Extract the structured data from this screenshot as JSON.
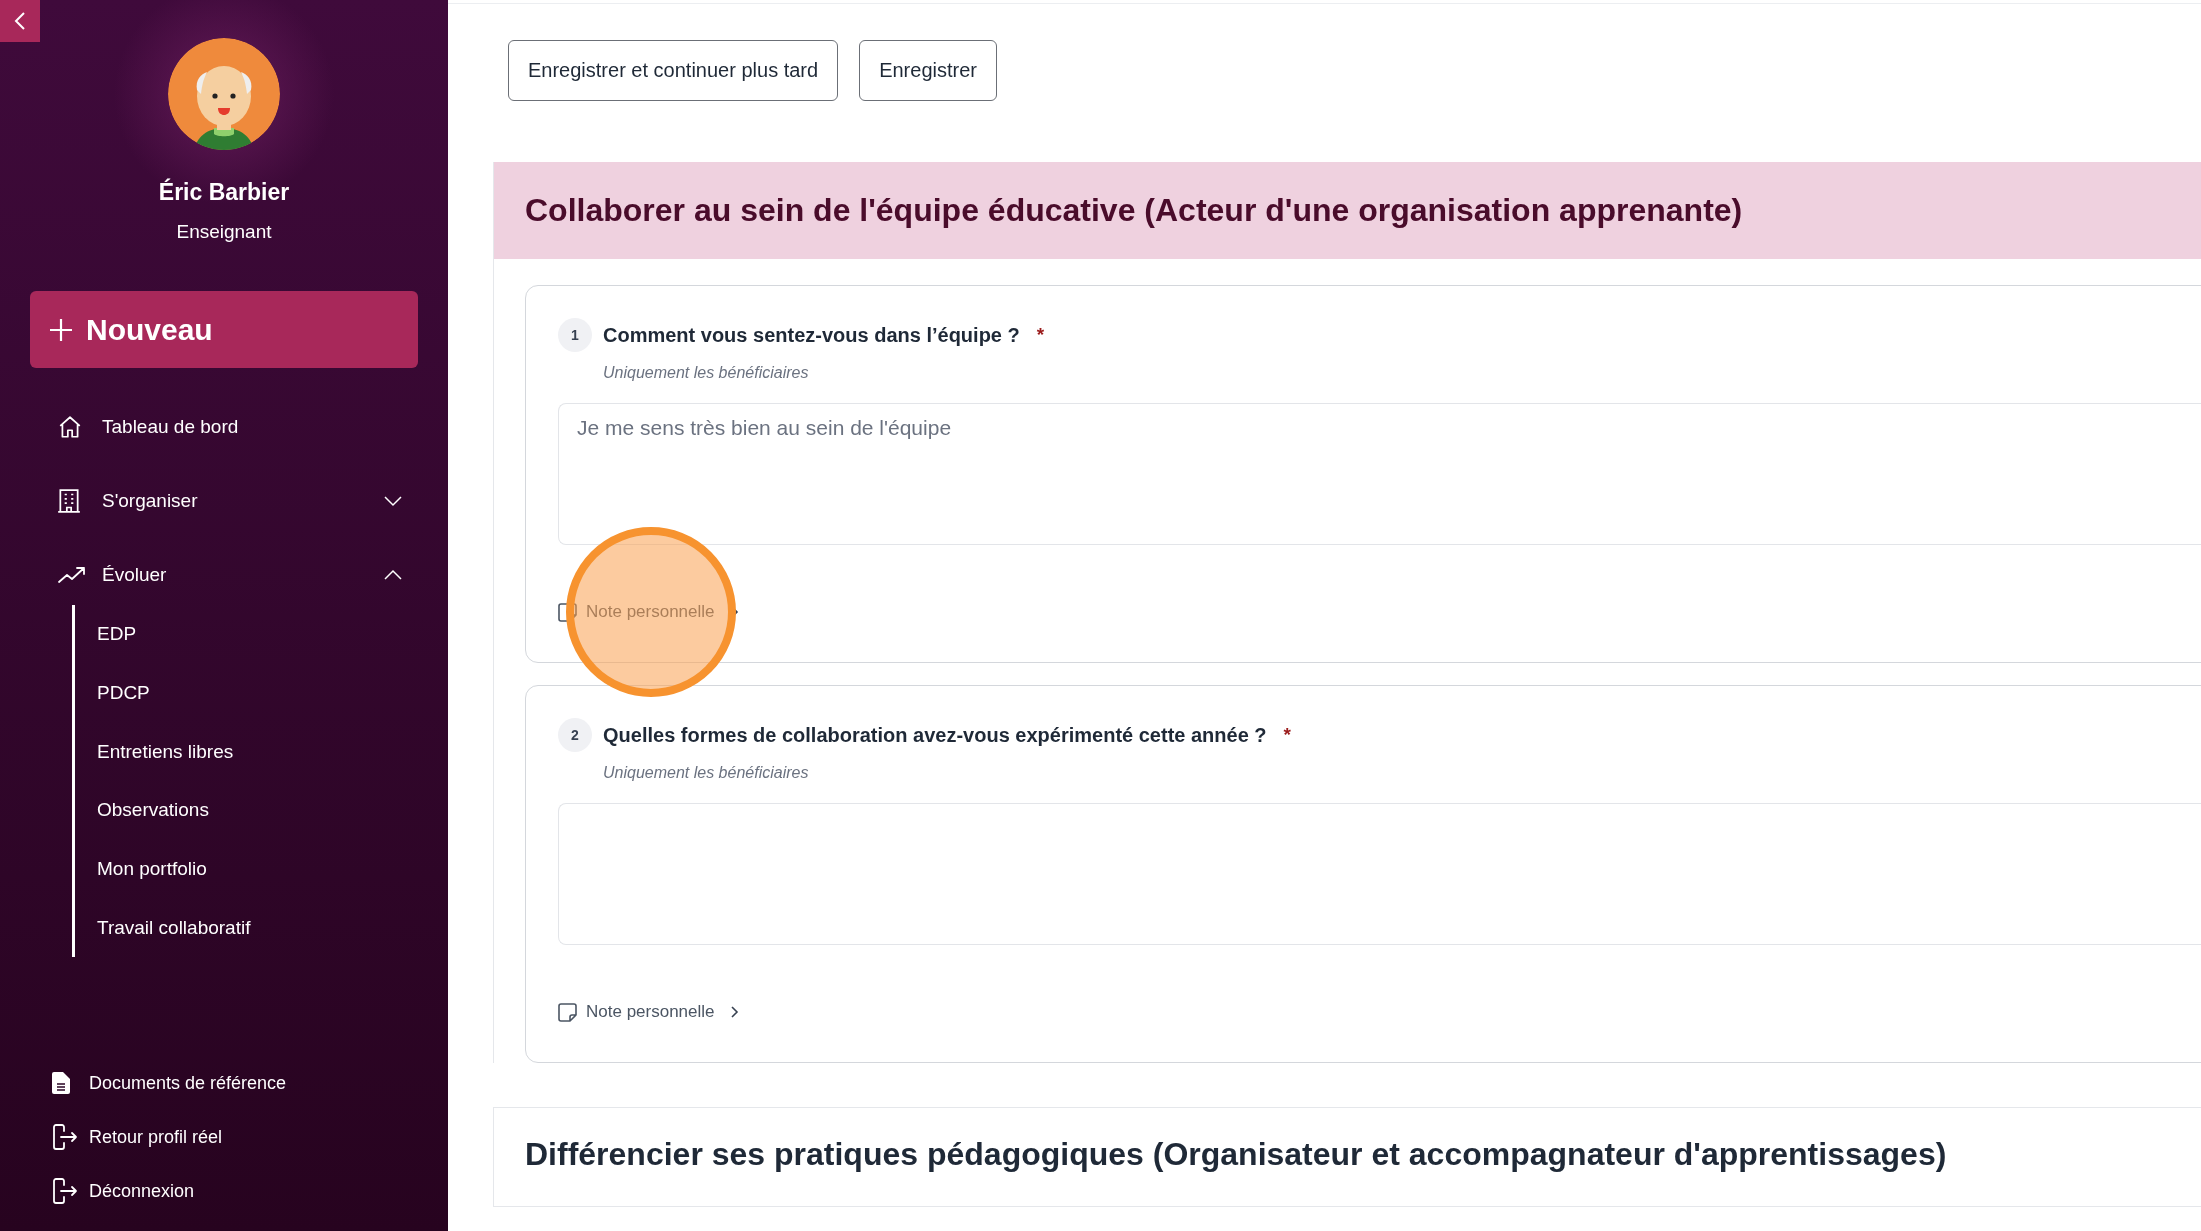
{
  "sidebar": {
    "profile": {
      "name": "Éric Barbier",
      "role": "Enseignant"
    },
    "new_button": "Nouveau",
    "nav": [
      {
        "label": "Tableau de bord",
        "kind": "link"
      },
      {
        "label": "S'organiser",
        "kind": "group",
        "expanded": false
      },
      {
        "label": "Évoluer",
        "kind": "group",
        "expanded": true,
        "children": [
          {
            "label": "EDP"
          },
          {
            "label": "PDCP"
          },
          {
            "label": "Entretiens libres"
          },
          {
            "label": "Observations"
          },
          {
            "label": "Mon portfolio"
          },
          {
            "label": "Travail collaboratif"
          }
        ]
      }
    ],
    "footer_links": [
      {
        "label": "Documents de référence"
      },
      {
        "label": "Retour profil réel"
      },
      {
        "label": "Déconnexion"
      }
    ]
  },
  "toolbar": {
    "buttons": [
      "Enregistrer et continuer plus tard",
      "Enregistrer"
    ]
  },
  "sections": [
    {
      "title": "Collaborer au sein de l'équipe éducative (Acteur d'une organisation apprenante)",
      "highlighted": true,
      "questions": [
        {
          "number": "1",
          "text": "Comment vous sentez-vous dans l’équipe ?",
          "required_mark": "*",
          "audience": "Uniquement les bénéficiaires",
          "answer": "Je me sens très bien au sein de l'équipe",
          "note_link": "Note personnelle",
          "click_marker": true
        },
        {
          "number": "2",
          "text": "Quelles formes de collaboration avez-vous expérimenté cette année ?",
          "required_mark": "*",
          "audience": "Uniquement les bénéficiaires",
          "note_link": "Note personnelle",
          "click_marker": false
        }
      ]
    },
    {
      "title": "Différencier ses pratiques pédagogiques (Organisateur et accompagnateur d'apprentissages)",
      "highlighted": false
    }
  ]
}
